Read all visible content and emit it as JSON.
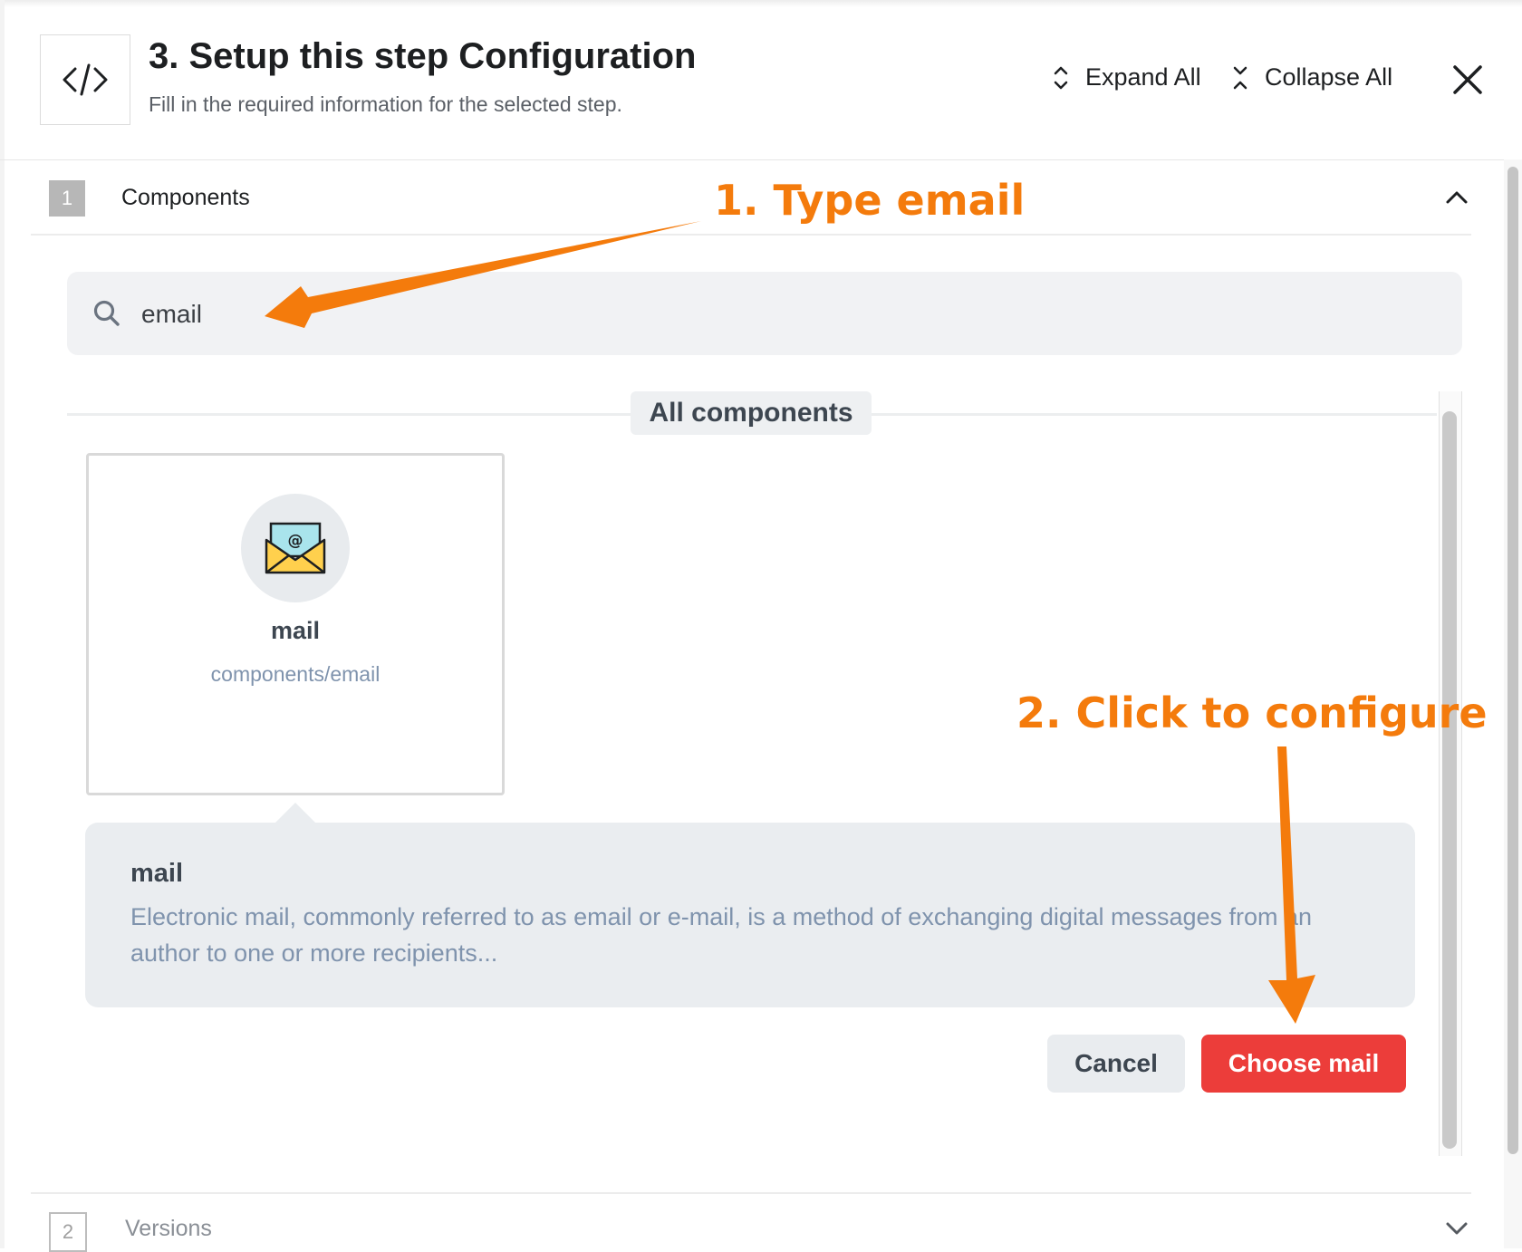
{
  "header": {
    "title": "3. Setup this step Configuration",
    "subtitle": "Fill in the required information for the selected step.",
    "step_icon": "code-brackets-icon",
    "expand_all": "Expand All",
    "collapse_all": "Collapse All"
  },
  "sections": [
    {
      "number": "1",
      "label": "Components",
      "state": "expanded"
    },
    {
      "number": "2",
      "label": "Versions",
      "state": "collapsed"
    }
  ],
  "search": {
    "value": "email",
    "icon": "search-icon"
  },
  "group_label": "All components",
  "components": [
    {
      "name": "mail",
      "path": "components/email",
      "icon": "envelope-icon"
    }
  ],
  "selected": {
    "title": "mail",
    "description": "Electronic mail, commonly referred to as email or e-mail, is a method of exchanging digital messages from an author to one or more recipients..."
  },
  "buttons": {
    "cancel": "Cancel",
    "choose": "Choose mail"
  },
  "annotations": {
    "step1": "1. Type email",
    "step2": "2. Click to configure"
  },
  "colors": {
    "accent_red": "#ec3d3a",
    "annotation_orange": "#f47b0c"
  }
}
